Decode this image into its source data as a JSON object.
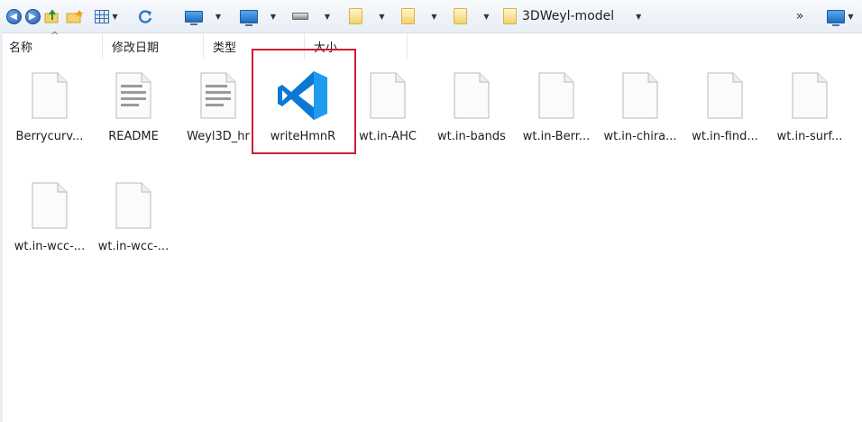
{
  "toolbar": {
    "path_current": "3DWeyl-model",
    "overflow_glyph": "»",
    "icons": [
      "back-icon",
      "forward-icon",
      "up-folder-icon",
      "new-folder-icon",
      "view-grid-icon",
      "refresh-icon",
      "desktop-icon",
      "computer-icon",
      "drive-icon",
      "folder-icon",
      "folder-icon",
      "folder-icon",
      "folder-icon",
      "monitor-icon"
    ]
  },
  "columns": [
    {
      "label": "名称"
    },
    {
      "label": "修改日期"
    },
    {
      "label": "类型"
    },
    {
      "label": "大小"
    }
  ],
  "sort_indicator": "^",
  "files": [
    {
      "name": "Berrycurv...",
      "icon": "blank-document-icon"
    },
    {
      "name": "README",
      "icon": "text-document-icon"
    },
    {
      "name": "Weyl3D_hr",
      "icon": "text-document-icon"
    },
    {
      "name": "writeHmnR",
      "icon": "vscode-icon",
      "highlighted": true
    },
    {
      "name": "wt.in-AHC",
      "icon": "blank-document-icon"
    },
    {
      "name": "wt.in-bands",
      "icon": "blank-document-icon"
    },
    {
      "name": "wt.in-Berr...",
      "icon": "blank-document-icon"
    },
    {
      "name": "wt.in-chira...",
      "icon": "blank-document-icon"
    },
    {
      "name": "wt.in-find...",
      "icon": "blank-document-icon"
    },
    {
      "name": "wt.in-surf...",
      "icon": "blank-document-icon"
    },
    {
      "name": "wt.in-wcc-...",
      "icon": "blank-document-icon"
    },
    {
      "name": "wt.in-wcc-...",
      "icon": "blank-document-icon"
    }
  ],
  "colors": {
    "highlight_border": "#cc1f2f",
    "vscode_blue": "#0a78d4"
  }
}
